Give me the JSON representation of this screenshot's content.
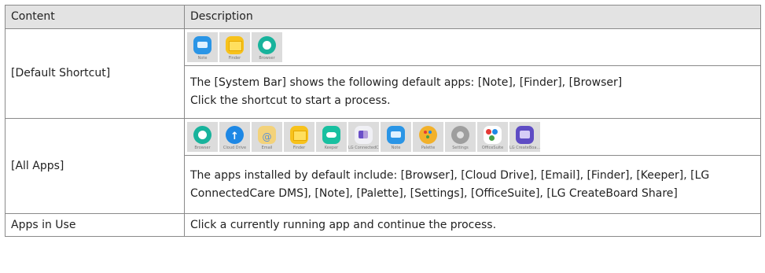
{
  "table": {
    "header": {
      "content": "Content",
      "description": "Description"
    },
    "default_shortcut": {
      "label": "[Default Shortcut]",
      "icons": [
        {
          "name": "note-icon",
          "caption": "Note"
        },
        {
          "name": "finder-icon",
          "caption": "Finder"
        },
        {
          "name": "browser-icon",
          "caption": "Browser"
        }
      ],
      "line1": "The [System Bar] shows the following default apps: [Note], [Finder], [Browser]",
      "line2": "Click the shortcut to start a process."
    },
    "all_apps": {
      "label": "[All Apps]",
      "icons": [
        {
          "name": "browser-icon",
          "caption": "Browser"
        },
        {
          "name": "cloud-drive-icon",
          "caption": "Cloud Drive"
        },
        {
          "name": "email-icon",
          "caption": "Email"
        },
        {
          "name": "finder-icon",
          "caption": "Finder"
        },
        {
          "name": "keeper-icon",
          "caption": "Keeper"
        },
        {
          "name": "lg-connectedcare-icon",
          "caption": "LG ConnectedC..."
        },
        {
          "name": "note-icon",
          "caption": "Note"
        },
        {
          "name": "palette-icon",
          "caption": "Palette"
        },
        {
          "name": "settings-icon",
          "caption": "Settings"
        },
        {
          "name": "officesuite-icon",
          "caption": "OfficeSuite"
        },
        {
          "name": "lg-createboard-share-icon",
          "caption": "LG CreateBoa..."
        }
      ],
      "text": "The apps installed by default include: [Browser], [Cloud Drive], [Email], [Finder], [Keeper], [LG ConnectedCare DMS], [Note], [Palette], [Settings], [OfficeSuite], [LG CreateBoard Share]"
    },
    "apps_in_use": {
      "label": "Apps in Use",
      "text": "Click a currently running app and continue the process."
    }
  },
  "colors": {
    "header_bg": "#e3e3e3",
    "border": "#8a8a8a",
    "tile_bg": "#dcdcdc"
  }
}
